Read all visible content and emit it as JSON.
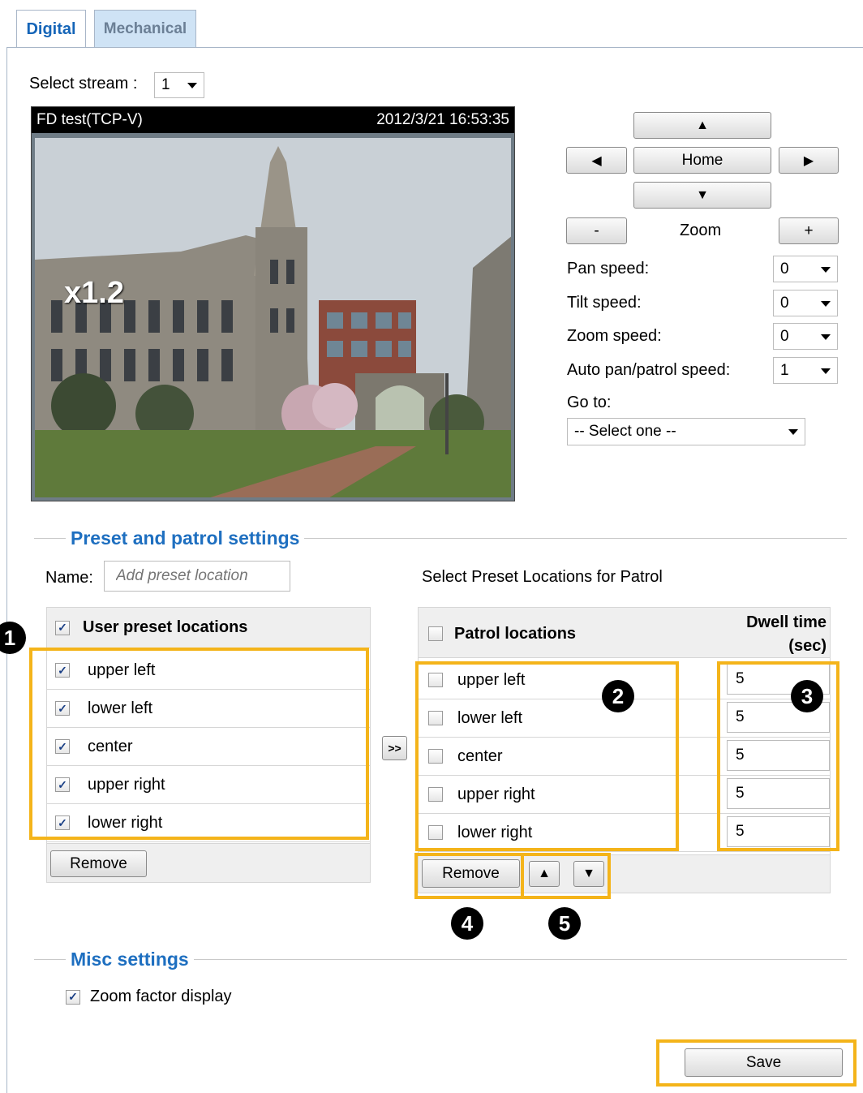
{
  "tabs": [
    {
      "label": "Digital",
      "active": true
    },
    {
      "label": "Mechanical",
      "active": false
    }
  ],
  "stream": {
    "label": "Select stream :",
    "value": "1"
  },
  "video": {
    "title": "FD test(TCP-V)",
    "timestamp": "2012/3/21 16:53:35",
    "zoom_factor": "x1.2"
  },
  "ptz": {
    "up_glyph": "▲",
    "down_glyph": "▼",
    "left_glyph": "◀",
    "right_glyph": "▶",
    "home_label": "Home",
    "zoom_out_label": "-",
    "zoom_label": "Zoom",
    "zoom_in_label": "+",
    "speeds": [
      {
        "label": "Pan speed:",
        "value": "0"
      },
      {
        "label": "Tilt speed:",
        "value": "0"
      },
      {
        "label": "Zoom speed:",
        "value": "0"
      },
      {
        "label": "Auto pan/patrol speed:",
        "value": "1"
      }
    ],
    "goto_label": "Go to:",
    "goto_value": "-- Select one --"
  },
  "preset": {
    "section_title": "Preset and patrol settings",
    "name_label": "Name:",
    "name_placeholder": "Add preset location",
    "patrol_caption": "Select Preset Locations for Patrol",
    "user_header": "User preset locations",
    "user_items": [
      "upper left",
      "lower left",
      "center",
      "upper right",
      "lower right"
    ],
    "remove_label": "Remove",
    "transfer_label": ">>",
    "patrol_header": "Patrol locations",
    "dwell_header_line1": "Dwell time",
    "dwell_header_line2": "(sec)",
    "patrol_items": [
      {
        "name": "upper left",
        "dwell": "5"
      },
      {
        "name": "lower left",
        "dwell": "5"
      },
      {
        "name": "center",
        "dwell": "5"
      },
      {
        "name": "upper right",
        "dwell": "5"
      },
      {
        "name": "lower right",
        "dwell": "5"
      }
    ],
    "patrol_remove_label": "Remove",
    "move_up_glyph": "▲",
    "move_down_glyph": "▼"
  },
  "misc": {
    "section_title": "Misc settings",
    "zoom_display_label": "Zoom factor display"
  },
  "save_label": "Save",
  "markers": [
    "1",
    "2",
    "3",
    "4",
    "5"
  ],
  "colors": {
    "accent": "#1e6fc0",
    "highlight": "#f4b41a",
    "tab_inactive": "#cfe3f5"
  }
}
